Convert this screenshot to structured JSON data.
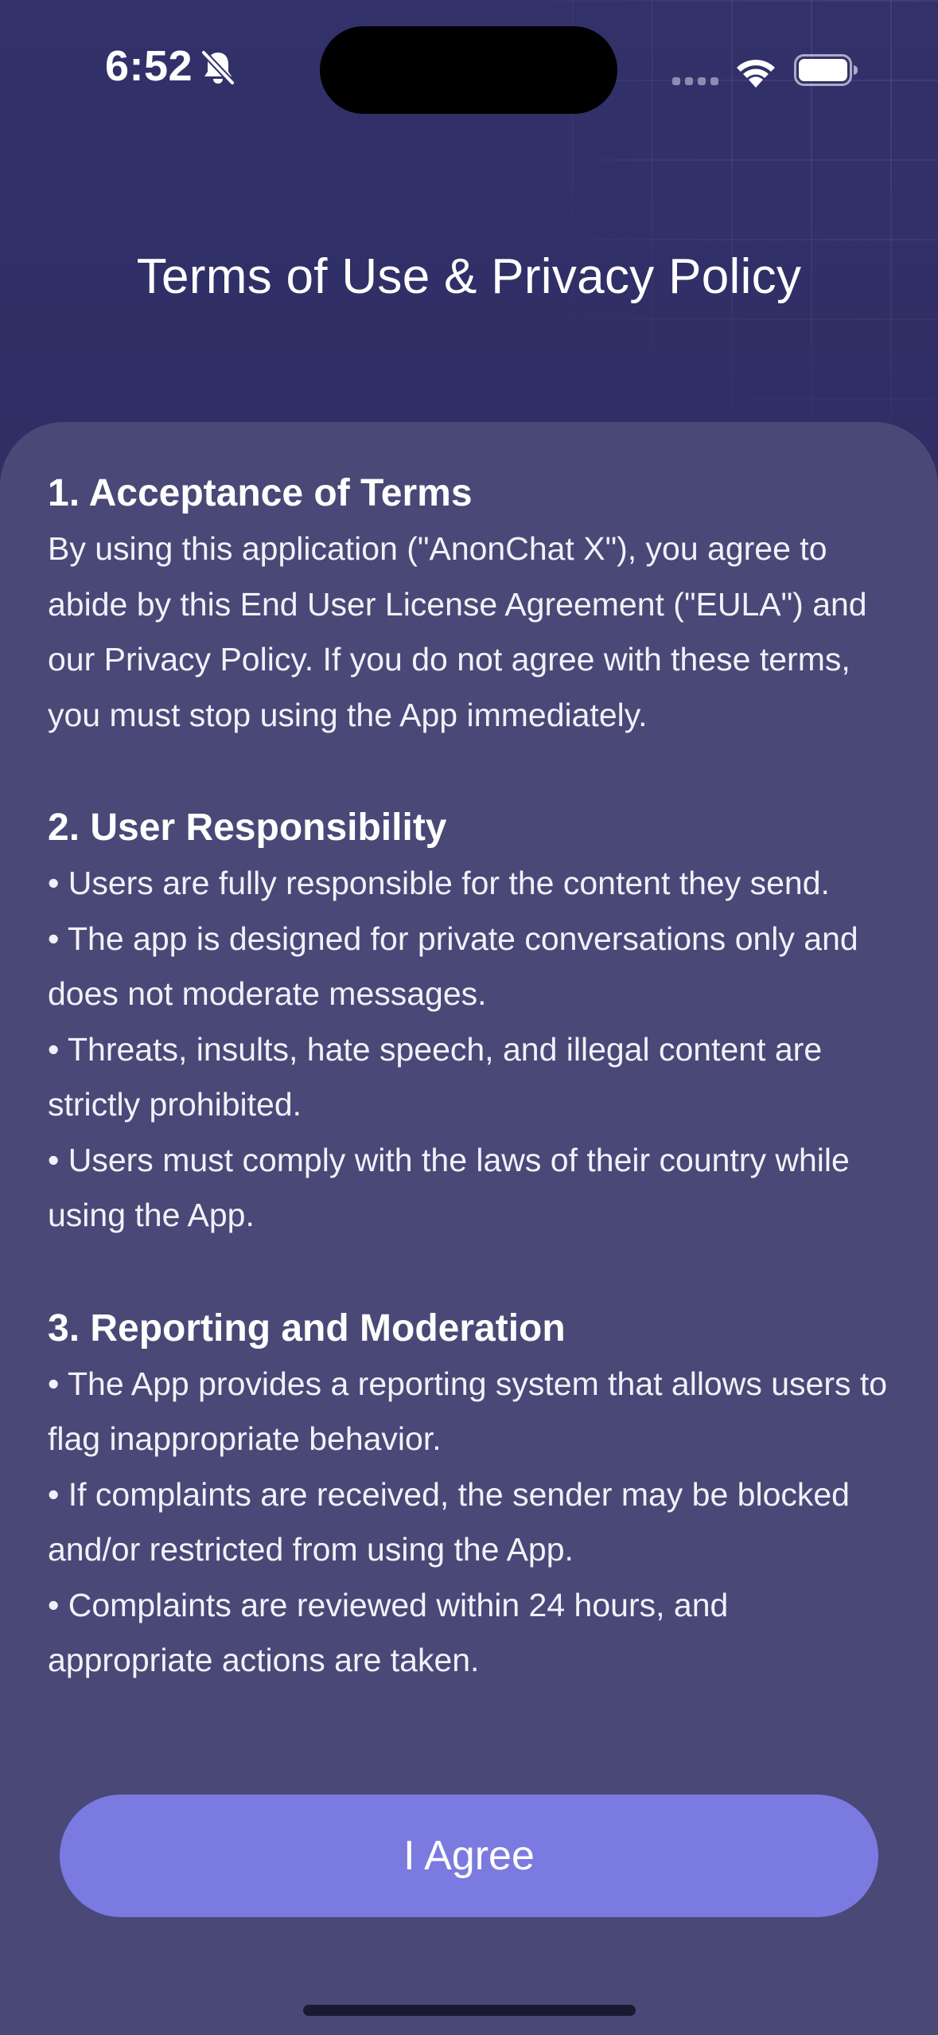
{
  "status_bar": {
    "time": "6:52",
    "icons": [
      "bell-off-icon",
      "cell-signal-icon",
      "wifi-icon",
      "battery-icon"
    ]
  },
  "header": {
    "title": "Terms of Use & Privacy Policy"
  },
  "terms": {
    "sections": [
      {
        "heading": "1. Acceptance of Terms",
        "paragraph": "By using this application (\"AnonChat X\"), you agree to abide by this End User License Agreement (\"EULA\") and our Privacy Policy. If you do not agree with these terms, you must stop using the App immediately."
      },
      {
        "heading": "2. User Responsibility",
        "bullets": [
          "• Users are fully responsible for the content they send.",
          "• The app is designed for private conversations only and does not moderate messages.",
          "• Threats, insults, hate speech, and illegal content are strictly prohibited.",
          "• Users must comply with the laws of their country while using the App."
        ]
      },
      {
        "heading": "3. Reporting and Moderation",
        "bullets": [
          "• The App provides a reporting system that allows users to flag inappropriate behavior.",
          "• If complaints are received, the sender may be blocked and/or restricted from using the App.",
          "• Complaints are reviewed within 24 hours, and appropriate actions are taken."
        ]
      }
    ]
  },
  "actions": {
    "agree_label": "I Agree"
  },
  "colors": {
    "background": "#2f2d63",
    "card": "#4a4876",
    "button": "#7b7ae0",
    "text": "#ffffff"
  }
}
